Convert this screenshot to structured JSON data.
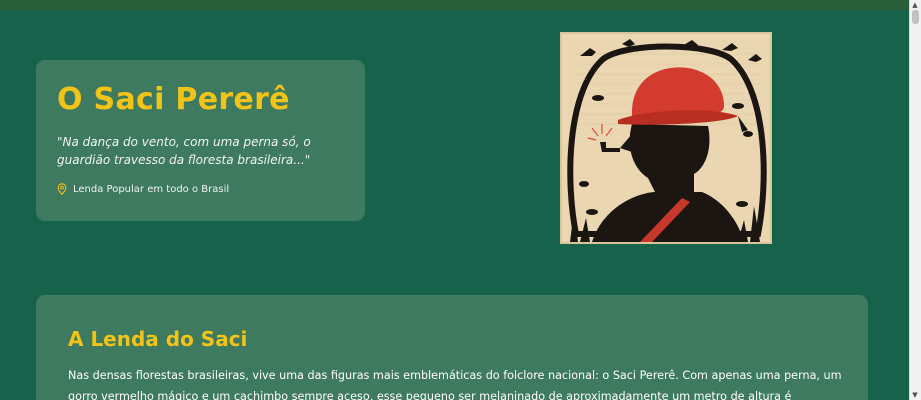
{
  "hero": {
    "title": "O Saci Pererê",
    "quote": "\"Na dança do vento, com uma perna só, o guardião travesso da floresta brasileira...\"",
    "location": "Lenda Popular em todo o Brasil",
    "location_icon": "map-pin-icon"
  },
  "image": {
    "alt": "Saci Pererê illustration"
  },
  "legend": {
    "title": "A Lenda do Saci",
    "text": "Nas densas florestas brasileiras, vive uma das figuras mais emblemáticas do folclore nacional: o Saci Pererê. Com apenas uma perna, um gorro vermelho mágico e um cachimbo sempre aceso, esse pequeno ser melaninado de aproximadamente um metro de altura é"
  },
  "colors": {
    "background": "#17624a",
    "card": "#3d7a5f",
    "accent": "#f2c418",
    "text": "#f1f5f2"
  }
}
